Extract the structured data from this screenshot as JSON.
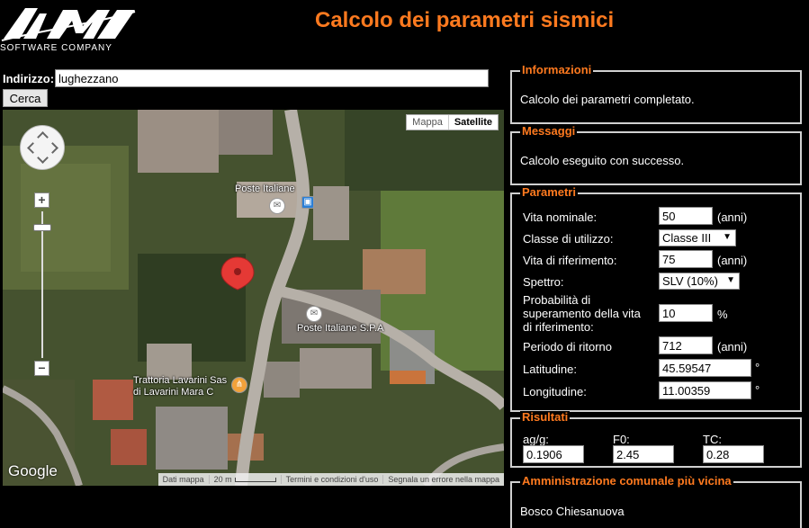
{
  "header": {
    "logo_text": "AMV",
    "logo_sub": "SOFTWARE COMPANY",
    "title": "Calcolo dei parametri sismici"
  },
  "address": {
    "label": "Indirizzo:",
    "value": "lughezzano",
    "search_label": "Cerca"
  },
  "map": {
    "type_buttons": [
      "Mappa",
      "Satellite"
    ],
    "active_type": "Satellite",
    "poi": [
      {
        "label": "Poste Italiane"
      },
      {
        "label": "Poste Italiane S.P.A"
      },
      {
        "label": "Trattoria Lavarini Sas\ndi Lavarini Mara C"
      }
    ],
    "google_logo": "Google",
    "footer": {
      "data": "Dati mappa",
      "scale": "20 m",
      "terms": "Termini e condizioni d'uso",
      "report": "Segnala un errore nella mappa"
    },
    "colors": {
      "pin": "#e53935"
    }
  },
  "informazioni": {
    "legend": "Informazioni",
    "text": "Calcolo dei parametri completato."
  },
  "messaggi": {
    "legend": "Messaggi",
    "text": "Calcolo eseguito con successo."
  },
  "parametri": {
    "legend": "Parametri",
    "vita_nominale": {
      "label": "Vita nominale:",
      "value": "50",
      "unit": "(anni)"
    },
    "classe_utilizzo": {
      "label": "Classe di utilizzo:",
      "value": "Classe III"
    },
    "vita_riferimento": {
      "label": "Vita di riferimento:",
      "value": "75",
      "unit": "(anni)"
    },
    "spettro": {
      "label": "Spettro:",
      "value": "SLV (10%)"
    },
    "probabilita": {
      "label_lines": [
        "Probabilità di",
        "superamento della vita",
        "di riferimento:"
      ],
      "value": "10",
      "unit": "%"
    },
    "periodo_ritorno": {
      "label": "Periodo di ritorno",
      "value": "712",
      "unit": "(anni)"
    },
    "latitudine": {
      "label": "Latitudine:",
      "value": "45.59547",
      "unit": "°"
    },
    "longitudine": {
      "label": "Longitudine:",
      "value": "11.00359",
      "unit": "°"
    }
  },
  "risultati": {
    "legend": "Risultati",
    "ag": {
      "label": "ag/g:",
      "value": "0.1906"
    },
    "f0": {
      "label": "F0:",
      "value": "2.45"
    },
    "tc": {
      "label": "TC:",
      "value": "0.28"
    }
  },
  "amministrazione": {
    "legend": "Amministrazione comunale più vicina",
    "text": "Bosco Chiesanuova"
  },
  "colors": {
    "accent": "#ff7a1f",
    "background": "#000000",
    "panel_border": "#d0d0d0"
  }
}
